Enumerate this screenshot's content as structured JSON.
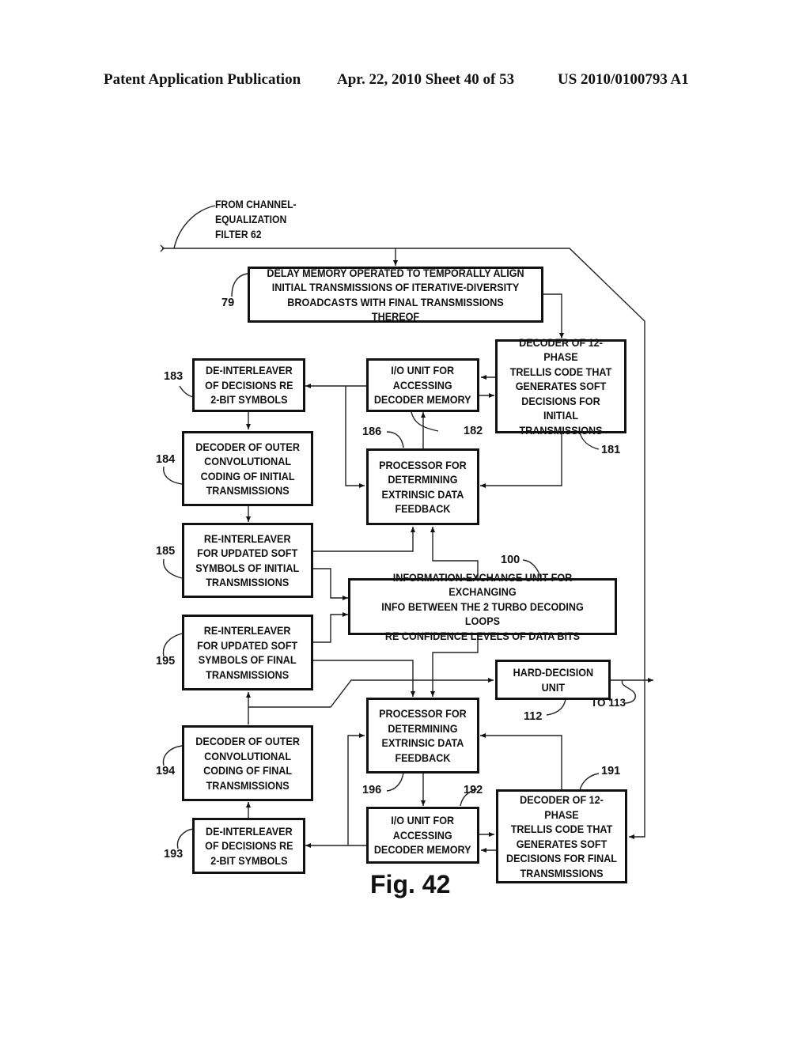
{
  "header": {
    "left": "Patent Application Publication",
    "center": "Apr. 22, 2010  Sheet 40 of 53",
    "right": "US 2010/0100793 A1"
  },
  "input_note": "FROM CHANNEL-\nEQUALIZATION\nFILTER 62",
  "output_note": "TO 113",
  "figure_label": "Fig. 42",
  "blocks": {
    "delay_memory": {
      "ref": "79",
      "text": "DELAY MEMORY OPERATED TO TEMPORALLY ALIGN\nINITIAL TRANSMISSIONS OF ITERATIVE-DIVERSITY\nBROADCASTS WITH FINAL TRANSMISSIONS THEREOF"
    },
    "deinterleaver_initial": {
      "ref": "183",
      "text": "DE-INTERLEAVER\nOF DECISIONS RE\n2-BIT SYMBOLS"
    },
    "io_unit_initial": {
      "ref": "182",
      "text": "I/O UNIT FOR\nACCESSING\nDECODER MEMORY"
    },
    "trellis_decoder_initial": {
      "ref": "181",
      "text": "DECODER OF 12-PHASE\nTRELLIS CODE THAT\nGENERATES SOFT\nDECISIONS FOR INITIAL\nTRANSMISSIONS"
    },
    "outer_decoder_initial": {
      "ref": "184",
      "text": "DECODER OF OUTER\nCONVOLUTIONAL\nCODING OF INITIAL\nTRANSMISSIONS"
    },
    "processor_initial": {
      "ref": "186",
      "text": "PROCESSOR FOR\nDETERMINING\nEXTRINSIC DATA\nFEEDBACK"
    },
    "reinterleaver_initial": {
      "ref": "185",
      "text": "RE-INTERLEAVER\nFOR UPDATED SOFT\nSYMBOLS OF INITIAL\nTRANSMISSIONS"
    },
    "info_exchange": {
      "ref": "100",
      "text": "INFORMATION-EXCHANGE UNIT FOR EXCHANGING\nINFO BETWEEN THE 2 TURBO DECODING LOOPS\nRE CONFIDENCE LEVELS OF DATA BITS"
    },
    "reinterleaver_final": {
      "ref": "195",
      "text": "RE-INTERLEAVER\nFOR UPDATED SOFT\nSYMBOLS OF FINAL\nTRANSMISSIONS"
    },
    "hard_decision": {
      "ref": "112",
      "text": "HARD-DECISION\nUNIT"
    },
    "outer_decoder_final": {
      "ref": "194",
      "text": "DECODER OF OUTER\nCONVOLUTIONAL\nCODING OF FINAL\nTRANSMISSIONS"
    },
    "processor_final": {
      "ref": "196",
      "text": "PROCESSOR FOR\nDETERMINING\nEXTRINSIC DATA\nFEEDBACK"
    },
    "deinterleaver_final": {
      "ref": "193",
      "text": "DE-INTERLEAVER\nOF DECISIONS RE\n2-BIT SYMBOLS"
    },
    "io_unit_final": {
      "ref": "192",
      "text": "I/O UNIT FOR\nACCESSING\nDECODER MEMORY"
    },
    "trellis_decoder_final": {
      "ref": "191",
      "text": "DECODER OF 12-PHASE\nTRELLIS CODE THAT\nGENERATES SOFT\nDECISIONS FOR FINAL\nTRANSMISSIONS"
    }
  }
}
